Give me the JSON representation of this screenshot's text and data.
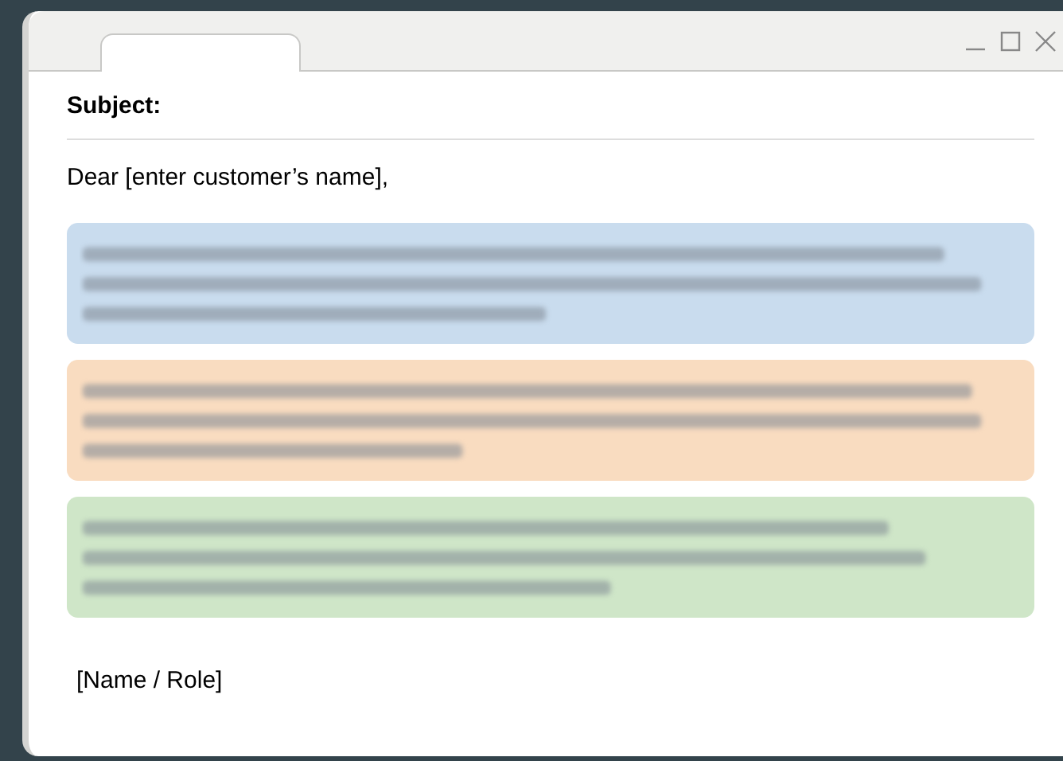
{
  "email": {
    "subject_label": "Subject:",
    "greeting": "Dear [enter customer’s name],",
    "sections": [
      {
        "color": "#c9dcee"
      },
      {
        "color": "#f9dcc0"
      },
      {
        "color": "#cfe6c8"
      }
    ],
    "signature": "[Name / Role]"
  }
}
